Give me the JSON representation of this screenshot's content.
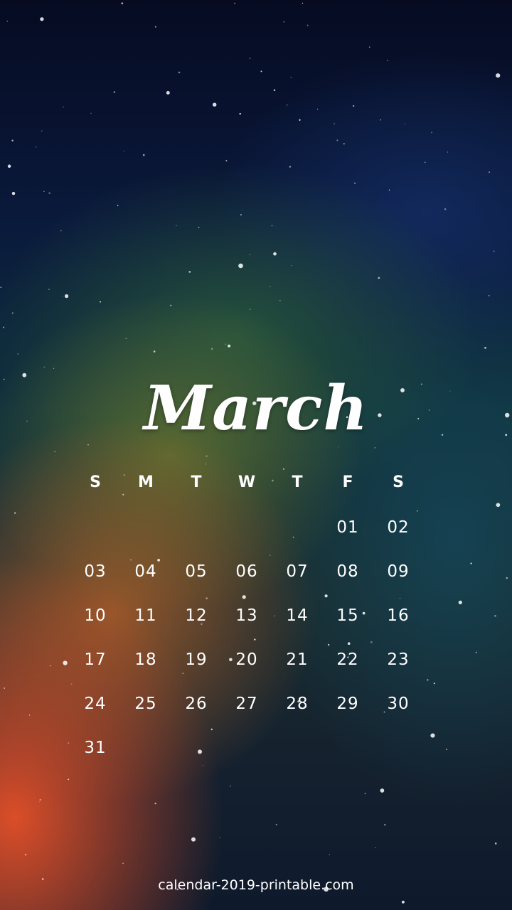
{
  "calendar": {
    "month": "March",
    "weekdays": [
      "S",
      "M",
      "T",
      "W",
      "T",
      "F",
      "S"
    ],
    "weeks": [
      [
        "",
        "",
        "",
        "",
        "",
        "01",
        "02"
      ],
      [
        "03",
        "04",
        "05",
        "06",
        "07",
        "08",
        "09"
      ],
      [
        "10",
        "11",
        "12",
        "13",
        "14",
        "15",
        "16"
      ],
      [
        "17",
        "18",
        "19",
        "20",
        "21",
        "22",
        "23"
      ],
      [
        "24",
        "25",
        "26",
        "27",
        "28",
        "29",
        "30"
      ],
      [
        "31",
        "",
        "",
        "",
        "",
        "",
        ""
      ]
    ]
  },
  "footer": {
    "site": "calendar-2019-printable.com"
  },
  "colors": {
    "text": "#ffffff",
    "sky_top": "#060b22",
    "nebula_orange": "#e65028",
    "nebula_green": "#2d5f3c"
  }
}
